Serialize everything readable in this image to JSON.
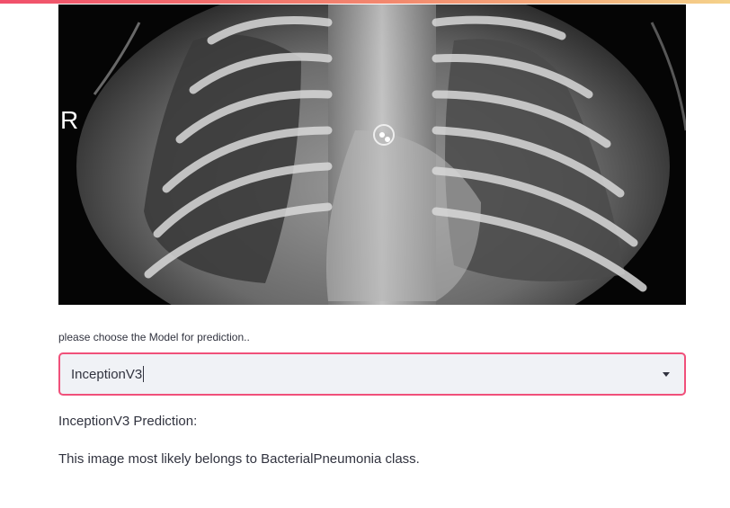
{
  "image": {
    "marker_text": "R"
  },
  "model_select": {
    "label": "please choose the Model for prediction..",
    "selected": "InceptionV3"
  },
  "result": {
    "title": "InceptionV3 Prediction:",
    "text": "This image most likely belongs to BacterialPneumonia class."
  },
  "colors": {
    "accent": "#f0507a",
    "select_bg": "#f0f2f6",
    "text": "#31333f"
  },
  "icons": {
    "dropdown": "chevron-down-icon"
  }
}
